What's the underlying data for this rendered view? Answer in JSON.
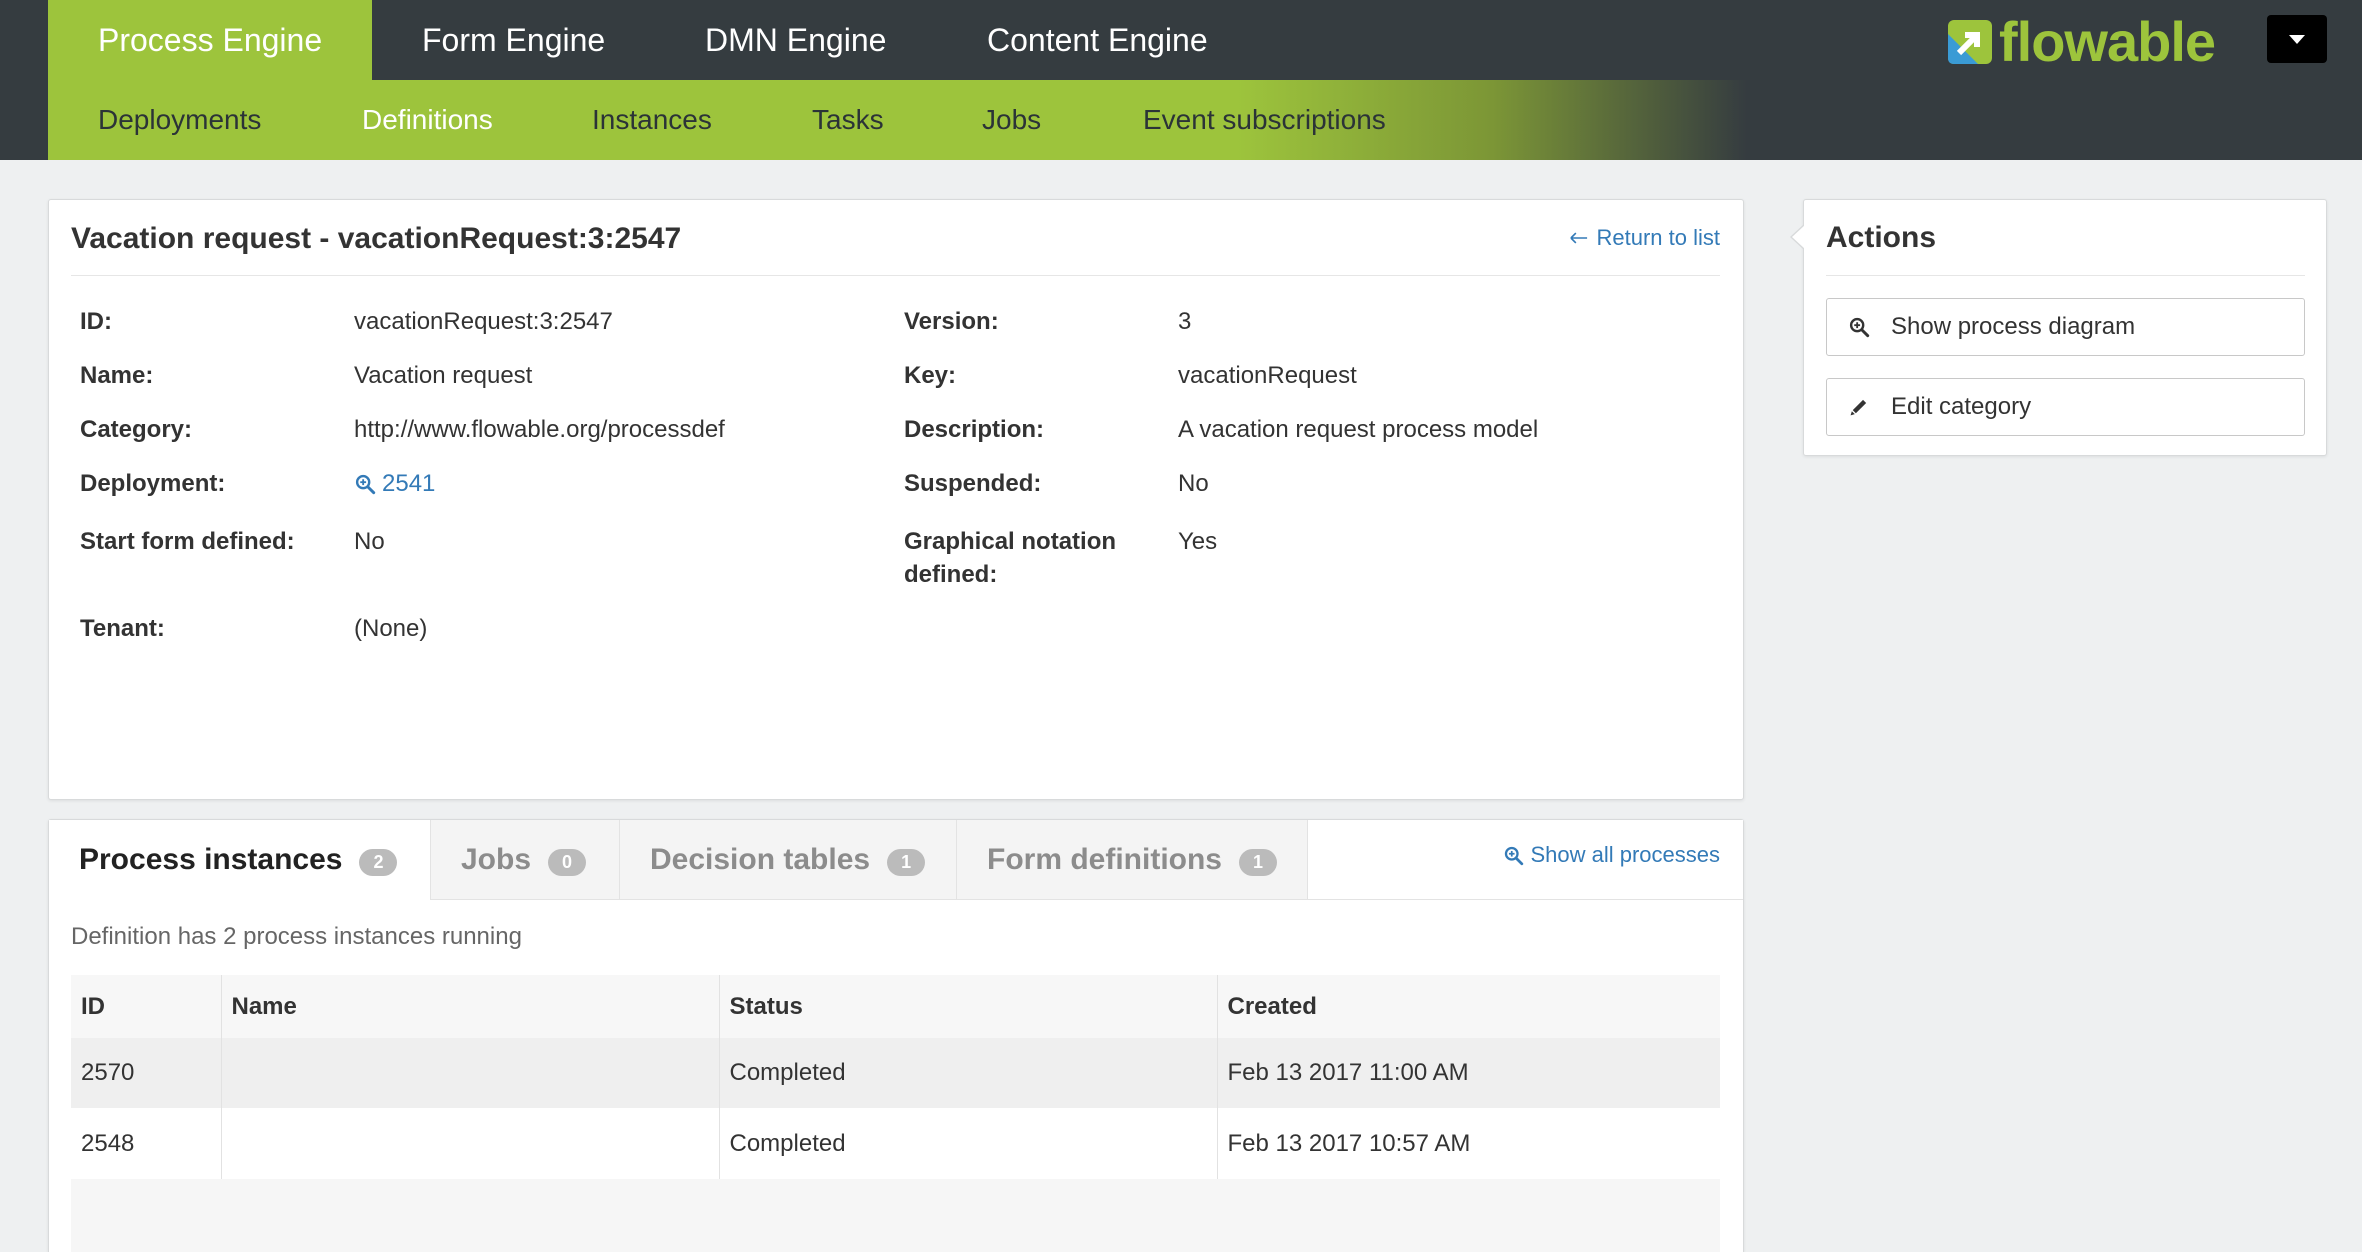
{
  "colors": {
    "brand_green": "#9dc43c",
    "nav_dark": "#353c40",
    "link_blue": "#337ab7",
    "page_background": "#eef0f1"
  },
  "header": {
    "logo_text": "flowable",
    "logo_icon": "flowable-logo-icon",
    "user_menu_icon": "caret-down-icon",
    "engine_tabs": [
      {
        "label": "Process Engine",
        "active": true
      },
      {
        "label": "Form Engine",
        "active": false
      },
      {
        "label": "DMN Engine",
        "active": false
      },
      {
        "label": "Content Engine",
        "active": false
      }
    ],
    "sub_nav": [
      {
        "label": "Deployments",
        "active": false
      },
      {
        "label": "Definitions",
        "active": true
      },
      {
        "label": "Instances",
        "active": false
      },
      {
        "label": "Tasks",
        "active": false
      },
      {
        "label": "Jobs",
        "active": false
      },
      {
        "label": "Event subscriptions",
        "active": false
      }
    ]
  },
  "definition": {
    "title": "Vacation request - vacationRequest:3:2547",
    "return_link": {
      "label": "Return to list",
      "icon": "arrow-left-icon"
    },
    "details": [
      {
        "left": {
          "label": "ID:",
          "value": "vacationRequest:3:2547"
        },
        "right": {
          "label": "Version:",
          "value": "3"
        }
      },
      {
        "left": {
          "label": "Name:",
          "value": "Vacation request"
        },
        "right": {
          "label": "Key:",
          "value": "vacationRequest"
        }
      },
      {
        "left": {
          "label": "Category:",
          "value": "http://www.flowable.org/processdef"
        },
        "right": {
          "label": "Description:",
          "value": "A vacation request process model"
        }
      },
      {
        "left": {
          "label": "Deployment:",
          "value": "2541",
          "icon": "search-icon"
        },
        "right": {
          "label": "Suspended:",
          "value": "No"
        }
      },
      {
        "left": {
          "label": "Start form defined:",
          "value": "No"
        },
        "right": {
          "label": "Graphical notation defined:",
          "value": "Yes"
        }
      },
      {
        "left": {
          "label": "Tenant:",
          "value": "(None)"
        }
      }
    ]
  },
  "actions": {
    "title": "Actions",
    "buttons": [
      {
        "label": "Show process diagram",
        "icon": "search-icon"
      },
      {
        "label": "Edit category",
        "icon": "pencil-icon"
      }
    ]
  },
  "related": {
    "tabs": [
      {
        "label": "Process instances",
        "count": 2,
        "active": true
      },
      {
        "label": "Jobs",
        "count": 0,
        "active": false
      },
      {
        "label": "Decision tables",
        "count": 1,
        "active": false
      },
      {
        "label": "Form definitions",
        "count": 1,
        "active": false
      }
    ],
    "show_all_link": {
      "label": "Show all processes",
      "icon": "search-icon"
    },
    "summary": "Definition has 2 process instances running",
    "table": {
      "columns": [
        "ID",
        "Name",
        "Status",
        "Created"
      ],
      "rows": [
        {
          "id": "2570",
          "name": "",
          "status": "Completed",
          "created": "Feb 13 2017 11:00 AM"
        },
        {
          "id": "2548",
          "name": "",
          "status": "Completed",
          "created": "Feb 13 2017 10:57 AM"
        }
      ]
    }
  }
}
